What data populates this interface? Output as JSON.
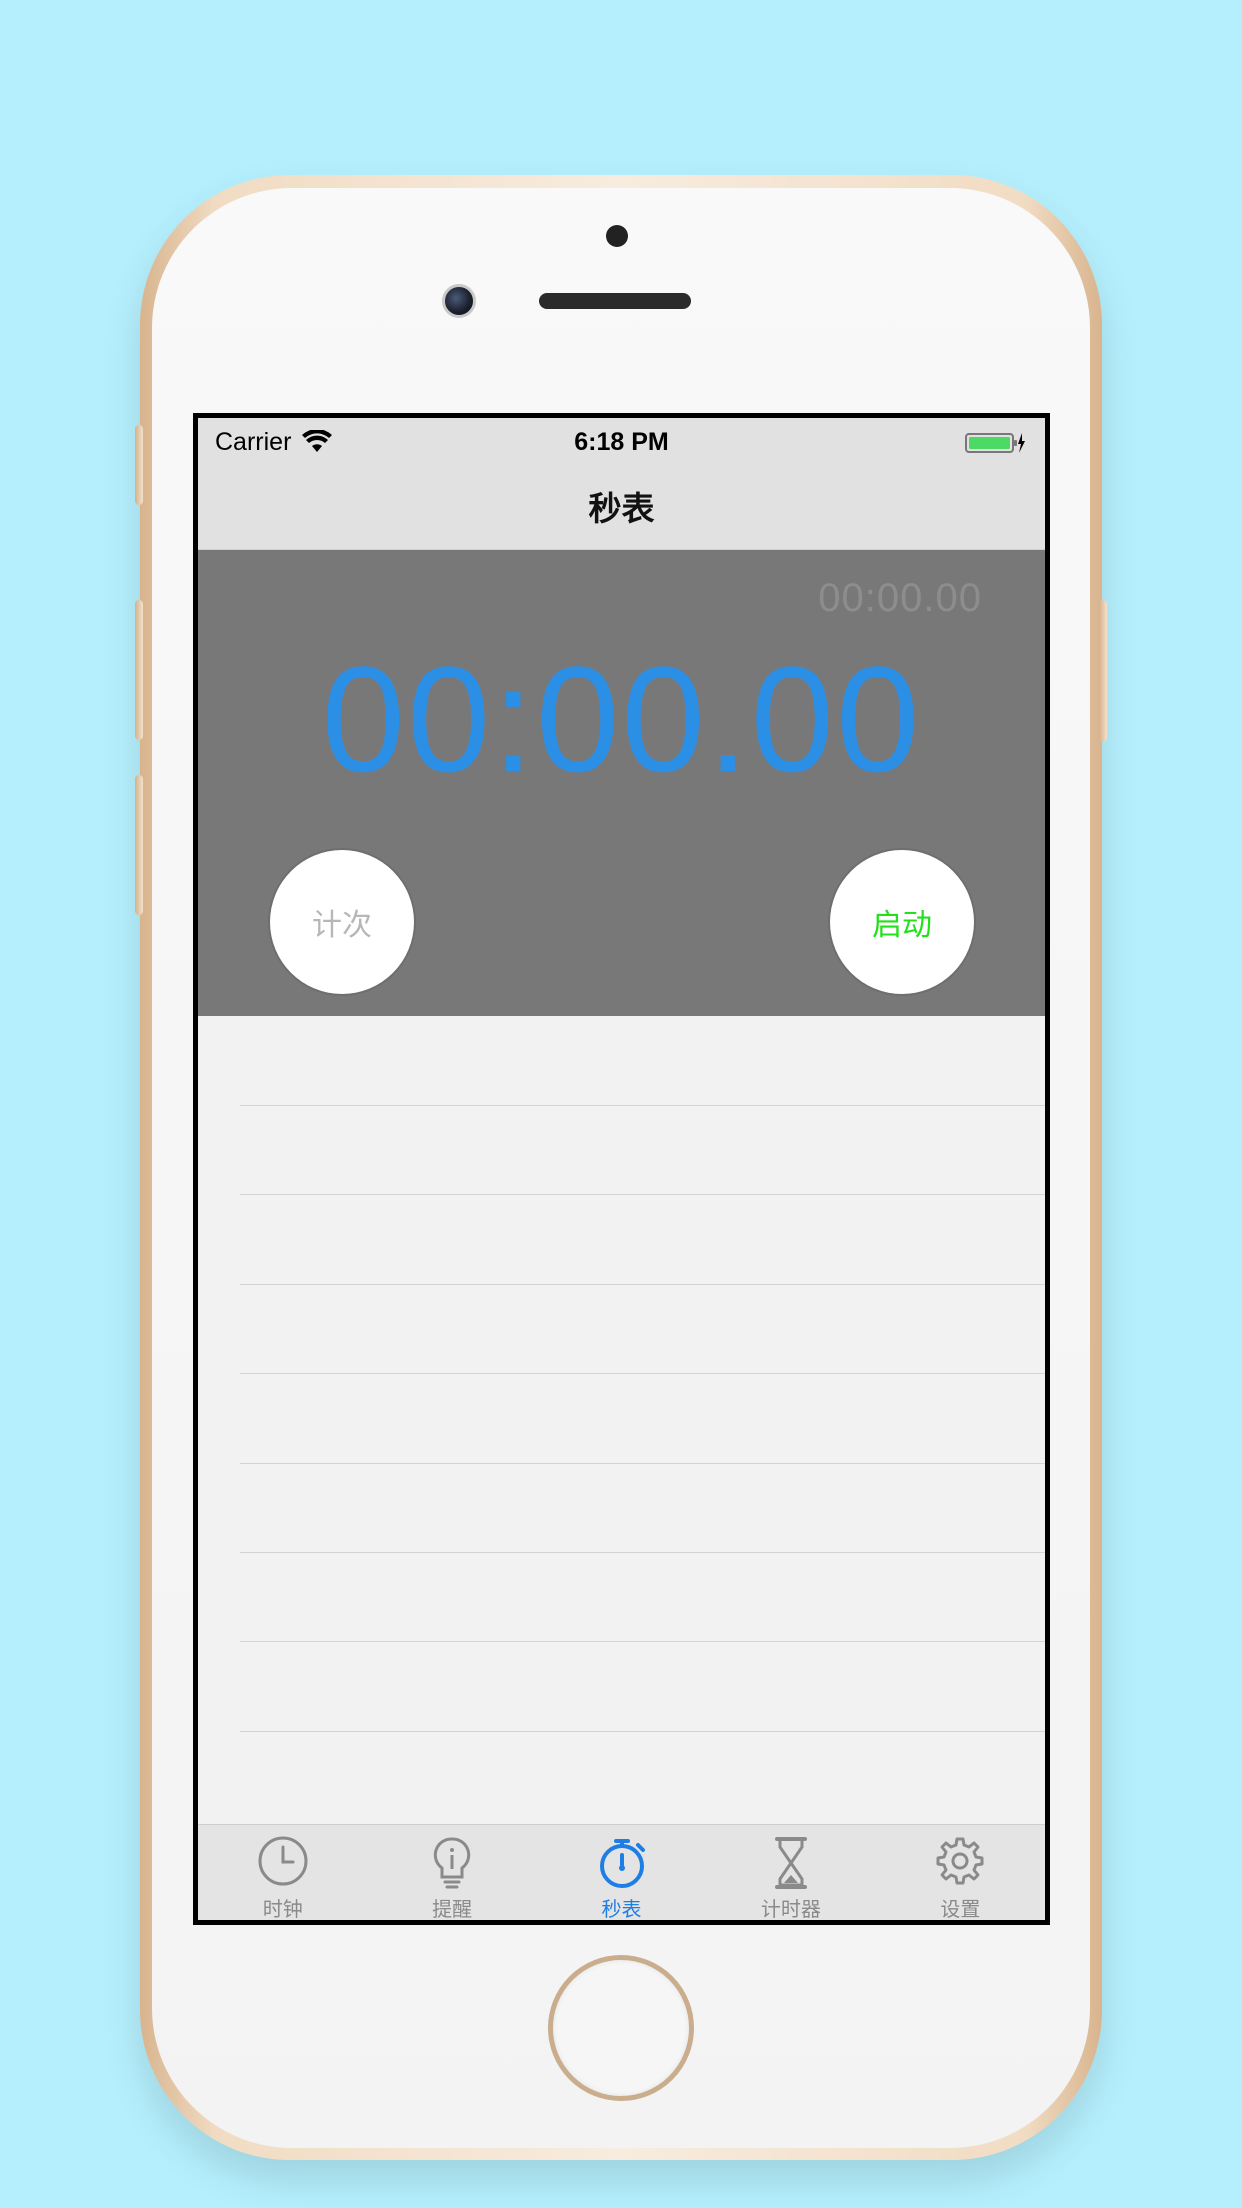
{
  "status_bar": {
    "carrier": "Carrier",
    "time": "6:18 PM",
    "wifi_icon": "wifi-icon",
    "battery_icon": "battery-charging-icon",
    "battery_color": "#4cd964"
  },
  "nav_bar": {
    "title": "秒表"
  },
  "stopwatch": {
    "lap_time": "00:00.00",
    "main_time": "00:00.00",
    "main_time_color": "#2c8fe6",
    "lap_button_label": "计次",
    "start_button_label": "启动",
    "start_button_color": "#22e11a"
  },
  "lap_list": {
    "rows": 8
  },
  "tab_bar": {
    "active_color": "#1e7ee6",
    "tabs": [
      {
        "label": "时钟",
        "icon": "clock-icon",
        "active": false
      },
      {
        "label": "提醒",
        "icon": "lightbulb-icon",
        "active": false
      },
      {
        "label": "秒表",
        "icon": "stopwatch-icon",
        "active": true
      },
      {
        "label": "计时器",
        "icon": "hourglass-icon",
        "active": false
      },
      {
        "label": "设置",
        "icon": "gear-icon",
        "active": false
      }
    ]
  },
  "background_color": "#b5effd"
}
